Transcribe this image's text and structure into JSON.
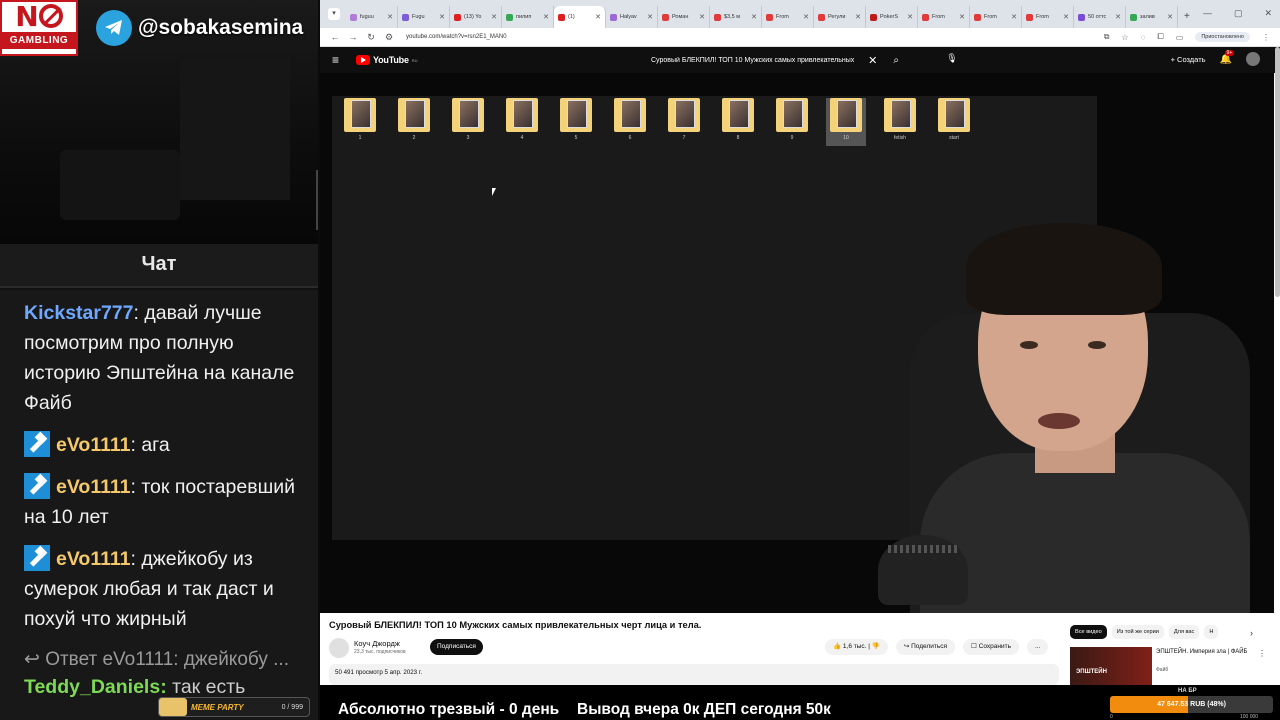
{
  "overlay": {
    "logo_no": "N",
    "logo_gambling": "GAMBLING",
    "telegram_handle": "@sobakasemina",
    "chat_title": "Чат",
    "sober_text": "Абсолютно трезвый - 0 день",
    "dep_text": "Вывод вчера 0к  ДЕП сегодня 50к",
    "bet_label": "НА БР",
    "progress_text": "47 647.53 RUB (48%)",
    "progress_fraction": 0.48,
    "progress_min": "0",
    "progress_max": "100 000",
    "meme_label": "MEME PARTY",
    "meme_count": "0 / 999"
  },
  "chat": {
    "messages": [
      {
        "user": "Kickstar777",
        "color": "#6fa8ff",
        "text": "давай лучше посмотрим про полную историю Эпштейна на канале Файб",
        "badge": false
      },
      {
        "user": "eVo1111",
        "color": "#f5c86a",
        "text": "ага",
        "badge": true
      },
      {
        "user": "eVo1111",
        "color": "#f5c86a",
        "text": "ток постаревший на 10 лет",
        "badge": true
      },
      {
        "user": "eVo1111",
        "color": "#f5c86a",
        "text": "джейкобу из сумерок любая и так даст и похуй что жирный",
        "badge": true
      }
    ],
    "reply_text": "Ответ eVo1111: джейкобу ...",
    "last_user": "Teddy_Daniels",
    "last_text": "так есть"
  },
  "browser": {
    "tabs": [
      {
        "label": "fuguu",
        "color": "#b07cd8",
        "active": false
      },
      {
        "label": "Fugu",
        "color": "#7c5cd8",
        "active": false
      },
      {
        "label": "(13) Yo",
        "color": "#e02020",
        "active": false
      },
      {
        "label": "пилип",
        "color": "#34a853",
        "active": false
      },
      {
        "label": "(1)",
        "color": "#e02020",
        "active": true
      },
      {
        "label": "Halyav",
        "color": "#9b6ad8",
        "active": false
      },
      {
        "label": "Роман",
        "color": "#e03a3a",
        "active": false
      },
      {
        "label": "$3,5 м",
        "color": "#e03a3a",
        "active": false
      },
      {
        "label": "From",
        "color": "#e03a3a",
        "active": false
      },
      {
        "label": "Регули",
        "color": "#e03a3a",
        "active": false
      },
      {
        "label": "PokerS",
        "color": "#c01a1a",
        "active": false
      },
      {
        "label": "From",
        "color": "#e03a3a",
        "active": false
      },
      {
        "label": "From",
        "color": "#e03a3a",
        "active": false
      },
      {
        "label": "From",
        "color": "#e03a3a",
        "active": false
      },
      {
        "label": "50 оттс",
        "color": "#7c4cd8",
        "active": false
      },
      {
        "label": "залив",
        "color": "#34a853",
        "active": false
      }
    ],
    "url": "youtube.com/watch?v=rsn2E1_MAN0",
    "paused_label": "Приостановлено"
  },
  "youtube": {
    "logo_text": "YouTube",
    "logo_region": "RU",
    "search_query": "Суровый БЛЕКПИЛ! ТОП 10 Мужских самых привлекательных",
    "create_label": "Создать",
    "notif_count": "9+",
    "video_title": "Суровый БЛЕКПИЛ! ТОП 10 Мужских самых привлекательных черт лица и тела.",
    "channel_name": "Коуч Джордж",
    "channel_subs": "23,3 тыс. подписчиков",
    "subscribe_label": "Подписаться",
    "likes": "1,6 тыс.",
    "share_label": "Поделиться",
    "save_label": "Сохранить",
    "more_label": "...",
    "description": "50 491 просмотр  5 апр. 2023 г.",
    "chips": [
      "Все видео",
      "Из той же серии",
      "Для вас",
      "Н"
    ],
    "rec_thumb_text": "ЭПШТЕЙН",
    "rec_title": "ЭПШТЕЙН. Империя зла | ФАЙБ",
    "rec_channel": "Файб"
  },
  "desktop": {
    "folders": [
      "1",
      "2",
      "3",
      "4",
      "5",
      "6",
      "7",
      "8",
      "9",
      "10",
      "fetish",
      "start"
    ]
  }
}
